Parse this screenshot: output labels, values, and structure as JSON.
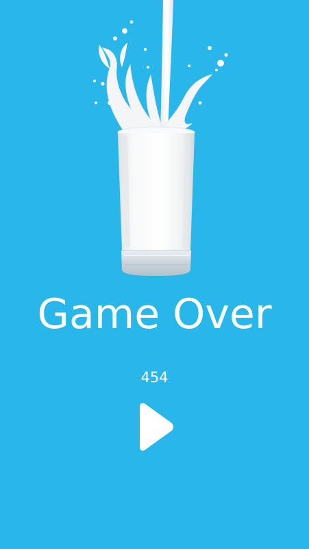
{
  "screen": {
    "background": "#29B6E8",
    "title": "Game Over",
    "score": "454"
  },
  "artwork": {
    "icon": "milk-glass-splash-icon"
  },
  "controls": {
    "play_icon": "play-icon"
  },
  "colors": {
    "text": "#ffffff",
    "milk": "#F4F5F6",
    "glass_shadow": "#D9DEE2"
  }
}
